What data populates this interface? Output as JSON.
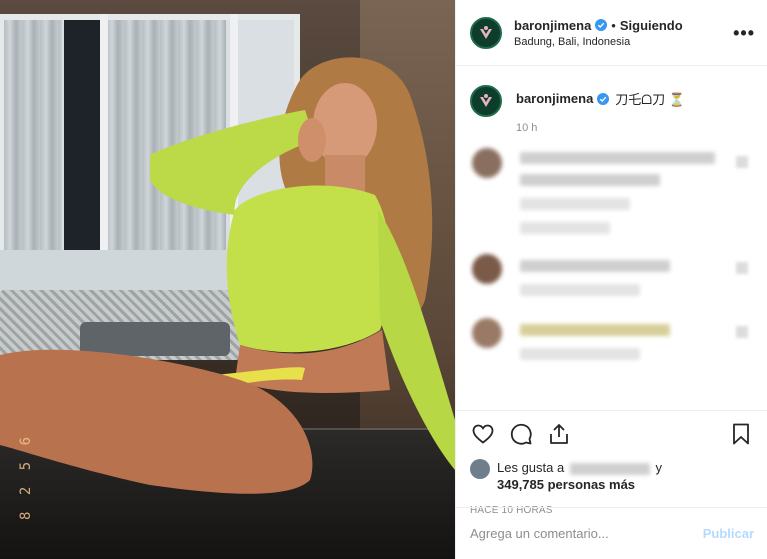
{
  "post": {
    "username": "baronjimena",
    "follow_state": "Siguiendo",
    "separator": "•",
    "location": "Badung, Bali, Indonesia",
    "more_icon": "more-options-icon"
  },
  "caption": {
    "username": "baronjimena",
    "text": "刀乇ᗝ刀 ⏳",
    "time": "10 h"
  },
  "photo": {
    "date_stamp": "8 2 5 6"
  },
  "actions": {
    "like_icon": "heart-icon",
    "comment_icon": "comment-icon",
    "share_icon": "share-icon",
    "save_icon": "bookmark-icon"
  },
  "likes": {
    "prefix": "Les gusta a",
    "suffix": "y",
    "count_text": "349,785 personas más"
  },
  "time_ago": "HACE 10 HORAS",
  "comment_box": {
    "placeholder": "Agrega un comentario...",
    "publish_label": "Publicar"
  },
  "colors": {
    "verified": "#3897f0",
    "publish_disabled": "#b3dbff",
    "avatar_bg": "#0f3d2c"
  }
}
